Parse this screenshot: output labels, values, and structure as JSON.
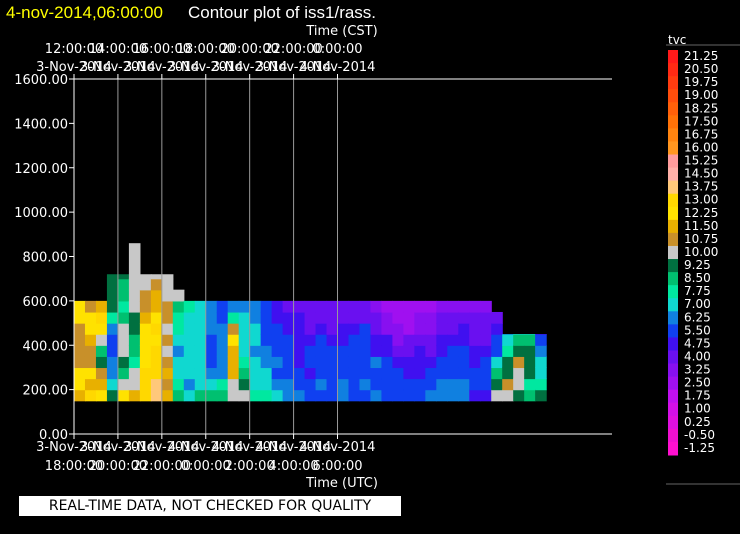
{
  "header": {
    "timestamp": "4-nov-2014,06:00:00",
    "title": "Contour plot of iss1/rass."
  },
  "notice": "REAL-TIME DATA, NOT CHECKED FOR QUALITY",
  "colors": {
    "background": "#000000",
    "timestamp": "#ffff00",
    "text": "#ffffff"
  },
  "chart_data": {
    "type": "heatmap",
    "top_axis_label": "Time (CST)",
    "xlabel": "Time (UTC)",
    "ylabel": "",
    "ylim": [
      0,
      1600
    ],
    "xlim_hours": [
      18,
      42.5
    ],
    "grid": true,
    "y_ticks": [
      "0.00",
      "200.00",
      "400.00",
      "600.00",
      "800.00",
      "1000.00",
      "1200.00",
      "1400.00",
      "1600.00"
    ],
    "y_tick_values": [
      0,
      200,
      400,
      600,
      800,
      1000,
      1200,
      1400,
      1600
    ],
    "x_tick_hours": [
      18,
      20,
      22,
      24,
      26,
      28,
      30
    ],
    "x_ticks_bottom": [
      [
        "3-Nov-2014",
        "18:00:00"
      ],
      [
        "3-Nov-2014",
        "20:00:00"
      ],
      [
        "3-Nov-2014",
        "22:00:00"
      ],
      [
        "4-Nov-2014",
        "0:00:00"
      ],
      [
        "4-Nov-2014",
        "2:00:00"
      ],
      [
        "4-Nov-2014",
        "4:00:00"
      ],
      [
        "4-Nov-2014",
        "6:00:00"
      ]
    ],
    "x_ticks_top": [
      [
        "12:00:00",
        "3-Nov-2014"
      ],
      [
        "14:00:00",
        "3-Nov-2014"
      ],
      [
        "16:00:00",
        "3-Nov-2014"
      ],
      [
        "18:00:00",
        "3-Nov-2014"
      ],
      [
        "20:00:00",
        "3-Nov-2014"
      ],
      [
        "22:00:00",
        "3-Nov-2014"
      ],
      [
        "0:00:00",
        "4-Nov-2014"
      ]
    ],
    "colorbar": {
      "label": "tvc",
      "levels": [
        "21.25",
        "20.50",
        "19.75",
        "19.00",
        "18.25",
        "17.50",
        "16.75",
        "16.00",
        "15.25",
        "14.50",
        "13.75",
        "13.00",
        "12.25",
        "11.50",
        "10.75",
        "10.00",
        "9.25",
        "8.50",
        "7.75",
        "7.00",
        "6.25",
        "5.50",
        "4.75",
        "4.00",
        "3.25",
        "2.50",
        "1.75",
        "1.00",
        "0.25",
        "-0.50",
        "-1.25"
      ],
      "colors": [
        "#ff1a1a",
        "#ff2a14",
        "#ff3c10",
        "#ff4e0c",
        "#ff600a",
        "#ff7208",
        "#ff8410",
        "#ff9620",
        "#ff9c9c",
        "#ffb0a8",
        "#ffc87a",
        "#ffd800",
        "#ffe200",
        "#e8b000",
        "#c8902a",
        "#c8c8c8",
        "#007040",
        "#00c070",
        "#00e8a0",
        "#10d8d0",
        "#1080e0",
        "#1040f0",
        "#4010f0",
        "#6a10f0",
        "#8810f0",
        "#a010f0",
        "#c010f0",
        "#d410e8",
        "#e010e0",
        "#f010d0",
        "#ff10d0"
      ]
    },
    "field": {
      "y_bins_m": [
        150,
        200,
        250,
        300,
        350,
        400,
        450,
        500,
        550,
        600,
        650,
        700
      ],
      "columns": [
        {
          "t": 18.0,
          "top": 590,
          "v": [
            12.2,
            12.8,
            12.9,
            11.4,
            11.3,
            10.9,
            11.2,
            12.6,
            12.4,
            11.3,
            null,
            null
          ]
        },
        {
          "t": 18.5,
          "top": 590,
          "v": [
            13.2,
            12.2,
            12.6,
            11.0,
            11.1,
            12.2,
            12.7,
            12.5,
            11.0,
            10.2,
            null,
            null
          ]
        },
        {
          "t": 19.0,
          "top": 590,
          "v": [
            12.5,
            11.6,
            11.1,
            9.6,
            8.6,
            10.3,
            12.6,
            13.3,
            12.2,
            10.5,
            null,
            null
          ]
        },
        {
          "t": 19.5,
          "top": 720,
          "v": [
            9.8,
            7.0,
            6.4,
            6.4,
            5.5,
            6.1,
            6.6,
            8.0,
            9.5,
            9.5,
            9.7,
            9.8
          ]
        },
        {
          "t": 20.0,
          "top": 720,
          "v": [
            12.5,
            10.4,
            8.7,
            9.5,
            10.2,
            10.5,
            10.5,
            9.2,
            8.3,
            8.7,
            9.2,
            9.5
          ]
        },
        {
          "t": 20.5,
          "top": 860,
          "v": [
            11.8,
            10.4,
            10.3,
            8.3,
            8.5,
            8.9,
            9.5,
            9.6,
            10.2,
            10.5,
            10.3,
            10.2
          ]
        },
        {
          "t": 21.0,
          "top": 720,
          "v": [
            13.2,
            13.0,
            13.3,
            12.5,
            12.7,
            12.8,
            12.6,
            11.7,
            11.0,
            10.8,
            10.4,
            10.1
          ]
        },
        {
          "t": 21.5,
          "top": 720,
          "v": [
            14.0,
            14.4,
            13.5,
            13.5,
            13.1,
            12.6,
            13.0,
            12.9,
            12.2,
            11.5,
            10.8,
            10.2
          ]
        },
        {
          "t": 22.0,
          "top": 720,
          "v": [
            11.8,
            11.4,
            11.6,
            10.8,
            10.2,
            11.1,
            10.4,
            10.8,
            11.3,
            10.5,
            10.2,
            10.1
          ]
        },
        {
          "t": 22.5,
          "top": 650,
          "v": [
            9.0,
            7.9,
            7.0,
            7.5,
            6.8,
            7.5,
            7.8,
            8.3,
            9.0,
            10.3,
            10.2,
            null
          ]
        },
        {
          "t": 23.0,
          "top": 580,
          "v": [
            7.0,
            6.6,
            7.1,
            7.6,
            7.4,
            7.2,
            7.3,
            7.7,
            8.2,
            8.7,
            null,
            null
          ]
        },
        {
          "t": 23.5,
          "top": 580,
          "v": [
            8.5,
            7.6,
            7.1,
            7.3,
            7.2,
            7.1,
            7.5,
            7.5,
            7.2,
            7.3,
            null,
            null
          ]
        },
        {
          "t": 24.0,
          "top": 580,
          "v": [
            8.5,
            7.4,
            6.7,
            6.0,
            5.9,
            6.2,
            6.5,
            6.3,
            6.5,
            6.5,
            null,
            null
          ]
        },
        {
          "t": 24.5,
          "top": 580,
          "v": [
            8.7,
            8.0,
            6.6,
            6.3,
            6.3,
            6.5,
            6.6,
            5.8,
            5.9,
            6.3,
            null,
            null
          ]
        },
        {
          "t": 25.0,
          "top": 580,
          "v": [
            10.5,
            10.5,
            12.2,
            12.1,
            12.2,
            12.6,
            10.9,
            8.3,
            6.6,
            6.3,
            null,
            null
          ]
        },
        {
          "t": 25.5,
          "top": 580,
          "v": [
            10.1,
            9.3,
            8.8,
            7.8,
            7.2,
            7.2,
            7.6,
            7.4,
            6.7,
            6.0,
            null,
            null
          ]
        },
        {
          "t": 26.0,
          "top": 580,
          "v": [
            8.0,
            7.4,
            7.3,
            7.4,
            6.9,
            7.0,
            7.2,
            6.7,
            6.5,
            6.1,
            null,
            null
          ]
        },
        {
          "t": 26.5,
          "top": 580,
          "v": [
            8.2,
            7.5,
            7.0,
            6.9,
            6.3,
            6.0,
            5.7,
            5.8,
            6.2,
            5.8,
            null,
            null
          ]
        },
        {
          "t": 27.0,
          "top": 580,
          "v": [
            7.3,
            6.6,
            6.2,
            6.5,
            6.1,
            5.8,
            5.6,
            5.3,
            5.1,
            5.0,
            null,
            null
          ]
        },
        {
          "t": 27.5,
          "top": 580,
          "v": [
            6.5,
            6.3,
            5.8,
            6.0,
            5.8,
            5.5,
            5.1,
            4.8,
            4.6,
            4.5,
            null,
            null
          ]
        },
        {
          "t": 28.0,
          "top": 580,
          "v": [
            6.8,
            6.0,
            5.6,
            5.4,
            5.4,
            5.2,
            4.9,
            4.8,
            4.5,
            4.5,
            null,
            null
          ]
        },
        {
          "t": 28.5,
          "top": 580,
          "v": [
            5.8,
            6.0,
            5.4,
            5.5,
            5.5,
            4.8,
            4.2,
            4.4,
            4.6,
            4.0,
            null,
            null
          ]
        },
        {
          "t": 29.0,
          "top": 580,
          "v": [
            6.2,
            6.8,
            6.1,
            6.1,
            6.0,
            6.1,
            5.4,
            4.6,
            4.4,
            4.1,
            null,
            null
          ]
        },
        {
          "t": 29.5,
          "top": 580,
          "v": [
            6.2,
            6.0,
            6.0,
            5.8,
            5.8,
            5.2,
            4.5,
            4.5,
            4.4,
            4.1,
            null,
            null
          ]
        },
        {
          "t": 30.0,
          "top": 580,
          "v": [
            6.5,
            6.4,
            6.1,
            5.8,
            5.5,
            5.2,
            5.0,
            4.7,
            4.5,
            4.2,
            null,
            null
          ]
        },
        {
          "t": 30.5,
          "top": 580,
          "v": [
            6.2,
            6.0,
            5.8,
            5.9,
            5.5,
            5.5,
            5.0,
            4.3,
            4.0,
            4.0,
            null,
            null
          ]
        },
        {
          "t": 31.0,
          "top": 580,
          "v": [
            6.0,
            6.3,
            6.0,
            5.7,
            5.8,
            5.8,
            5.5,
            4.7,
            4.2,
            4.0,
            null,
            null
          ]
        },
        {
          "t": 31.5,
          "top": 580,
          "v": [
            6.8,
            6.1,
            6.0,
            6.3,
            5.3,
            5.3,
            4.6,
            4.5,
            3.5,
            3.6,
            null,
            null
          ]
        },
        {
          "t": 32.0,
          "top": 580,
          "v": [
            5.9,
            5.9,
            5.8,
            5.6,
            5.0,
            4.8,
            3.4,
            3.5,
            3.0,
            3.0,
            null,
            null
          ]
        },
        {
          "t": 32.5,
          "top": 580,
          "v": [
            5.6,
            6.2,
            5.5,
            5.3,
            4.6,
            3.8,
            3.3,
            2.8,
            3.0,
            2.9,
            null,
            null
          ]
        },
        {
          "t": 33.0,
          "top": 580,
          "v": [
            5.8,
            5.5,
            5.2,
            4.8,
            4.4,
            4.0,
            3.2,
            2.8,
            2.8,
            3.0,
            null,
            null
          ]
        },
        {
          "t": 33.5,
          "top": 580,
          "v": [
            5.8,
            5.6,
            5.3,
            5.1,
            4.9,
            4.2,
            3.9,
            3.4,
            3.0,
            2.8,
            null,
            null
          ]
        },
        {
          "t": 34.0,
          "top": 580,
          "v": [
            6.3,
            6.0,
            5.7,
            5.4,
            4.7,
            4.1,
            3.8,
            3.5,
            3.2,
            2.9,
            null,
            null
          ]
        },
        {
          "t": 34.5,
          "top": 580,
          "v": [
            6.3,
            6.5,
            6.2,
            5.8,
            5.3,
            5.1,
            4.5,
            4.0,
            3.7,
            3.5,
            null,
            null
          ]
        },
        {
          "t": 35.0,
          "top": 580,
          "v": [
            6.4,
            6.8,
            6.2,
            5.5,
            5.8,
            5.4,
            4.6,
            4.1,
            3.9,
            3.4,
            null,
            null
          ]
        },
        {
          "t": 35.5,
          "top": 580,
          "v": [
            6.5,
            6.4,
            6.1,
            6.0,
            5.5,
            5.4,
            5.0,
            4.1,
            3.7,
            3.5,
            null,
            null
          ]
        },
        {
          "t": 36.0,
          "top": 580,
          "v": [
            5.3,
            5.7,
            5.6,
            5.3,
            5.2,
            4.3,
            4.1,
            4.0,
            3.7,
            3.2,
            null,
            null
          ]
        },
        {
          "t": 36.5,
          "top": 580,
          "v": [
            5.3,
            5.9,
            5.9,
            5.9,
            5.1,
            4.7,
            4.3,
            4.0,
            3.5,
            3.4,
            null,
            null
          ]
        },
        {
          "t": 37.0,
          "top": 520,
          "v": [
            10.5,
            9.8,
            8.5,
            7.0,
            6.2,
            5.8,
            5.3,
            4.4,
            4.4,
            null,
            null,
            null
          ]
        },
        {
          "t": 37.5,
          "top": 450,
          "v": [
            10.2,
            11.2,
            9.6,
            9.3,
            8.0,
            7.2,
            6.6,
            null,
            null,
            null,
            null,
            null
          ]
        },
        {
          "t": 38.0,
          "top": 450,
          "v": [
            9.7,
            10.2,
            10.5,
            11.3,
            9.5,
            8.8,
            7.1,
            null,
            null,
            null,
            null,
            null
          ]
        },
        {
          "t": 38.5,
          "top": 450,
          "v": [
            8.6,
            8.2,
            9.3,
            9.8,
            9.5,
            9.0,
            7.2,
            null,
            null,
            null,
            null,
            null
          ]
        },
        {
          "t": 39.0,
          "top": 450,
          "v": [
            9.5,
            8.1,
            7.7,
            7.0,
            6.3,
            5.5,
            5.2,
            null,
            null,
            null,
            null,
            null
          ]
        }
      ]
    }
  }
}
